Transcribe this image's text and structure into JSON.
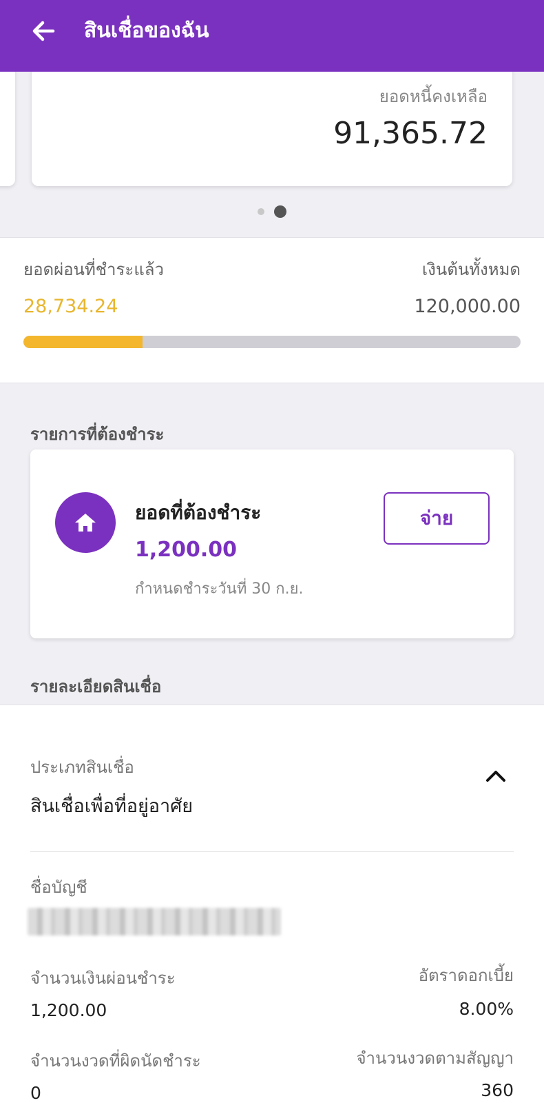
{
  "header": {
    "title": "สินเชื่อของฉัน",
    "back_icon": "arrow-left-icon"
  },
  "balance_card": {
    "label": "ยอดหนี้คงเหลือ",
    "value": "91,365.72"
  },
  "carousel": {
    "count": 2,
    "active": 2
  },
  "progress": {
    "paid_label": "ยอดผ่อนที่ชำระแล้ว",
    "paid_value": "28,734.24",
    "total_label": "เงินต้นทั้งหมด",
    "total_value": "120,000.00",
    "fraction": 0.2394,
    "fill_color": "#f3b62d",
    "track_color": "#cfced4"
  },
  "due": {
    "section_title": "รายการที่ต้องชำระ",
    "title": "ยอดที่ต้องชำระ",
    "amount": "1,200.00",
    "due_date": "กำหนดชำระวันที่ 30 ก.ย.",
    "pay_label": "จ่าย",
    "icon": "home-icon"
  },
  "details": {
    "section_title": "รายละเอียดสินเชื่อ",
    "loan_type_label": "ประเภทสินเชื่อ",
    "loan_type_value": "สินเชื่อเพื่อที่อยู่อาศัย",
    "collapse_icon": "chevron-up-icon",
    "account_name_label": "ชื่อบัญชี",
    "installment_label": "จำนวนเงินผ่อนชำระ",
    "installment_value": "1,200.00",
    "interest_label": "อัตราดอกเบี้ย",
    "interest_value": "8.00%",
    "overdue_label": "จำนวนงวดที่ผิดนัดชำระ",
    "overdue_value": "0",
    "contract_terms_label": "จำนวนงวดตามสัญญา",
    "contract_terms_value": "360"
  },
  "colors": {
    "primary": "#7b31bf",
    "accent": "#f3b62d",
    "background": "#f0eff4"
  }
}
